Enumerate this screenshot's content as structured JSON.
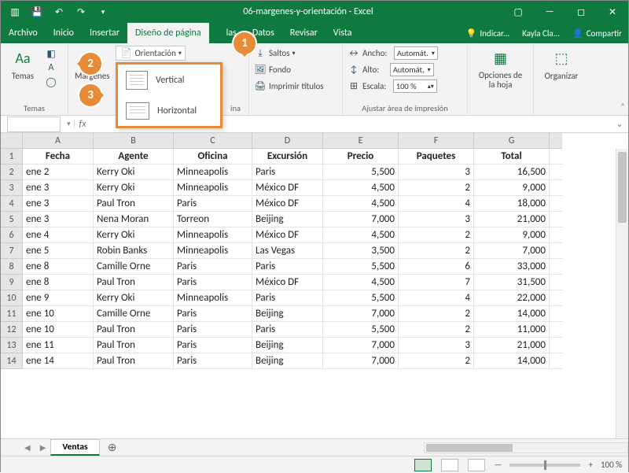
{
  "title": "06-margenes-y-orientación  -  Excel",
  "tabs": [
    "Archivo",
    "Inicio",
    "Insertar",
    "Diseño de página",
    "las",
    "Datos",
    "Revisar",
    "Vista"
  ],
  "active_tab_index": 3,
  "tell_me": "Indicar...",
  "user": "Kayla Cla...",
  "share": "Compartir",
  "ribbon": {
    "temas": "Temas",
    "temas_group": "Temas",
    "margenes": "Márgenes",
    "orientacion": "Orientación",
    "orient_vertical": "Vertical",
    "orient_horizontal": "Horizontal",
    "saltos": "Saltos",
    "fondo": "Fondo",
    "imprimir_titulos": "Imprimir títulos",
    "pagina_group": "ina",
    "ancho": "Ancho:",
    "alto": "Alto:",
    "auto": "Automát.",
    "escala": "Escala:",
    "escala_val": "100 %",
    "ajustar_group": "Ajustar área de impresión",
    "opciones": "Opciones de\nla hoja",
    "organizar": "Organizar"
  },
  "badges": {
    "b1": "1",
    "b2": "2",
    "b3": "3"
  },
  "columns": [
    "A",
    "B",
    "C",
    "D",
    "E",
    "F",
    "G"
  ],
  "headers": [
    "Fecha",
    "Agente",
    "Oficina",
    "Excursión",
    "Precio",
    "Paquetes",
    "Total"
  ],
  "rows": [
    {
      "n": 2,
      "d": [
        "ene 2",
        "Kerry Oki",
        "Minneapolis",
        "Paris",
        "5,500",
        "3",
        "16,500"
      ]
    },
    {
      "n": 3,
      "d": [
        "ene 3",
        "Kerry Oki",
        "Minneapolis",
        "México DF",
        "4,500",
        "2",
        "9,000"
      ]
    },
    {
      "n": 4,
      "d": [
        "ene 3",
        "Paul Tron",
        "Paris",
        "México DF",
        "4,500",
        "4",
        "18,000"
      ]
    },
    {
      "n": 5,
      "d": [
        "ene 3",
        "Nena Moran",
        "Torreon",
        "Beijing",
        "7,000",
        "3",
        "21,000"
      ]
    },
    {
      "n": 6,
      "d": [
        "ene 4",
        "Kerry Oki",
        "Minneapolis",
        "México DF",
        "4,500",
        "2",
        "9,000"
      ]
    },
    {
      "n": 7,
      "d": [
        "ene 5",
        "Robin Banks",
        "Minneapolis",
        "Las Vegas",
        "3,500",
        "2",
        "7,000"
      ]
    },
    {
      "n": 8,
      "d": [
        "ene 8",
        "Camille Orne",
        "Paris",
        "Paris",
        "5,500",
        "6",
        "33,000"
      ]
    },
    {
      "n": 9,
      "d": [
        "ene 8",
        "Paul Tron",
        "Paris",
        "México DF",
        "4,500",
        "7",
        "31,500"
      ]
    },
    {
      "n": 10,
      "d": [
        "ene 9",
        "Kerry Oki",
        "Minneapolis",
        "Paris",
        "5,500",
        "4",
        "22,000"
      ]
    },
    {
      "n": 11,
      "d": [
        "ene 10",
        "Camille Orne",
        "Paris",
        "Beijing",
        "7,000",
        "2",
        "14,000"
      ]
    },
    {
      "n": 12,
      "d": [
        "ene 10",
        "Paul Tron",
        "Paris",
        "Paris",
        "5,500",
        "2",
        "11,000"
      ]
    },
    {
      "n": 13,
      "d": [
        "ene 11",
        "Paul Tron",
        "Paris",
        "Beijing",
        "7,000",
        "3",
        "21,000"
      ]
    },
    {
      "n": 14,
      "d": [
        "ene 14",
        "Paul Tron",
        "Paris",
        "Beijing",
        "7,000",
        "2",
        "14,000"
      ]
    }
  ],
  "sheet_tab": "Ventas",
  "zoom": "100 %"
}
